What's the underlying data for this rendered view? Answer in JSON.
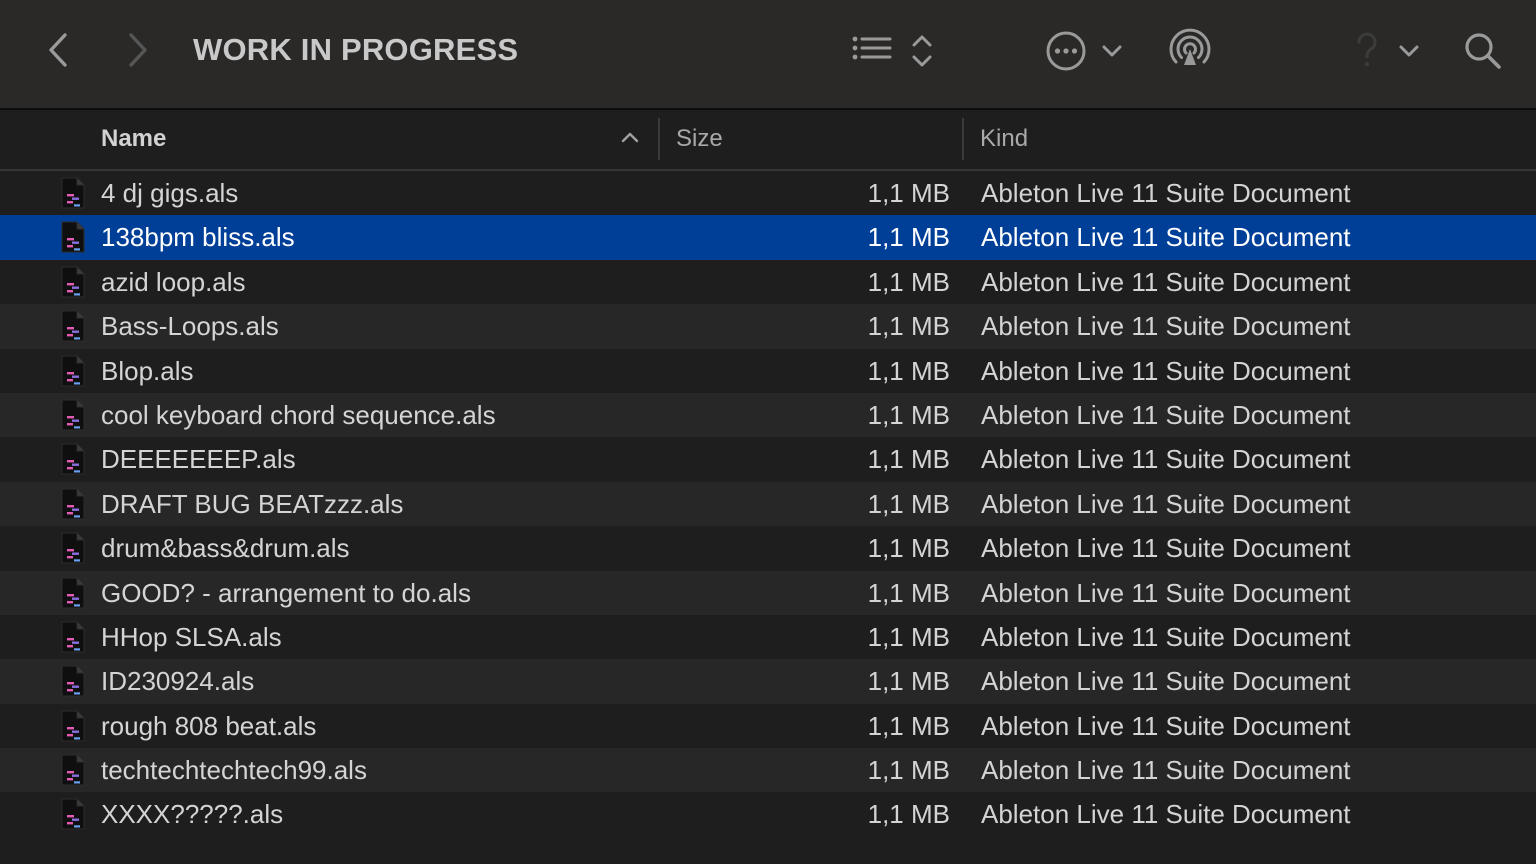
{
  "window": {
    "title": "WORK IN PROGRESS"
  },
  "toolbar": {
    "icons": [
      "back-icon",
      "forward-icon",
      "list-view-icon",
      "sort-toggle-icon",
      "more-options-icon",
      "chevron-down-icon",
      "airdrop-icon",
      "help-icon",
      "chevron-down-icon",
      "search-icon"
    ]
  },
  "columns": {
    "name": "Name",
    "size": "Size",
    "kind": "Kind",
    "sort": "ascending"
  },
  "colors": {
    "selection": "#003f98",
    "row_alt": "#272727",
    "background": "#1e1e1e",
    "toolbar": "#2a2928"
  },
  "files": [
    {
      "name": "4 dj gigs.als",
      "size": "1,1 MB",
      "kind": "Ableton Live 11 Suite Document"
    },
    {
      "name": "138bpm bliss.als",
      "size": "1,1 MB",
      "kind": "Ableton Live 11 Suite Document",
      "selected": true
    },
    {
      "name": "azid loop.als",
      "size": "1,1 MB",
      "kind": "Ableton Live 11 Suite Document"
    },
    {
      "name": "Bass-Loops.als",
      "size": "1,1 MB",
      "kind": "Ableton Live 11 Suite Document"
    },
    {
      "name": "Blop.als",
      "size": "1,1 MB",
      "kind": "Ableton Live 11 Suite Document"
    },
    {
      "name": "cool keyboard chord sequence.als",
      "size": "1,1 MB",
      "kind": "Ableton Live 11 Suite Document"
    },
    {
      "name": "DEEEEEEEP.als",
      "size": "1,1 MB",
      "kind": "Ableton Live 11 Suite Document"
    },
    {
      "name": "DRAFT BUG BEATzzz.als",
      "size": "1,1 MB",
      "kind": "Ableton Live 11 Suite Document"
    },
    {
      "name": "drum&bass&drum.als",
      "size": "1,1 MB",
      "kind": "Ableton Live 11 Suite Document"
    },
    {
      "name": "GOOD? - arrangement to do.als",
      "size": "1,1 MB",
      "kind": "Ableton Live 11 Suite Document"
    },
    {
      "name": "HHop SLSA.als",
      "size": "1,1 MB",
      "kind": "Ableton Live 11 Suite Document"
    },
    {
      "name": "ID230924.als",
      "size": "1,1 MB",
      "kind": "Ableton Live 11 Suite Document"
    },
    {
      "name": "rough 808 beat.als",
      "size": "1,1 MB",
      "kind": "Ableton Live 11 Suite Document"
    },
    {
      "name": "techtechtechtech99.als",
      "size": "1,1 MB",
      "kind": "Ableton Live 11 Suite Document"
    },
    {
      "name": "XXXX?????.als",
      "size": "1,1 MB",
      "kind": "Ableton Live 11 Suite Document"
    }
  ]
}
